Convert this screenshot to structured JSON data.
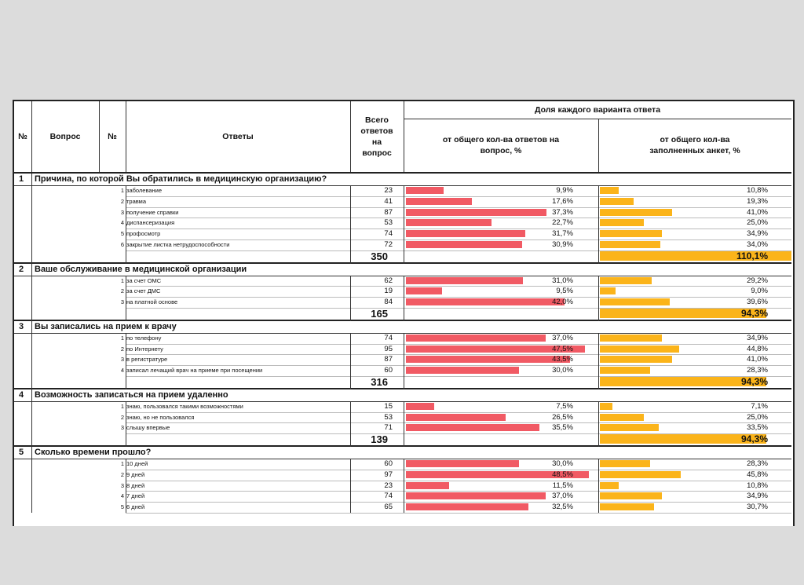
{
  "header": {
    "num": "№",
    "question": "Вопрос",
    "ans_num": "№",
    "answers": "Ответы",
    "total": "Всего ответов на вопрос",
    "share": "Доля каждого варианта ответа",
    "share_answers": "от общего кол-ва ответов на вопрос, %",
    "share_forms": "от общего кол-ва заполненных анкет, %"
  },
  "colors": {
    "answers_bar": "#f15a64",
    "forms_bar": "#fbb41a"
  },
  "questions": [
    {
      "num": "1",
      "text": "Причина, по которой Вы обратились в медицинскую организацию?",
      "total": "350",
      "total_forms_pct": "110,1%",
      "total_forms_value": 110.1,
      "answers": [
        {
          "n": "1",
          "text": "заболевание",
          "count": "23",
          "pct_a": "9,9%",
          "va": 9.9,
          "pct_f": "10,8%",
          "vf": 10.8
        },
        {
          "n": "2",
          "text": "травма",
          "count": "41",
          "pct_a": "17,6%",
          "va": 17.6,
          "pct_f": "19,3%",
          "vf": 19.3
        },
        {
          "n": "3",
          "text": "получение справки",
          "count": "87",
          "pct_a": "37,3%",
          "va": 37.3,
          "pct_f": "41,0%",
          "vf": 41.0
        },
        {
          "n": "4",
          "text": "диспансеризация",
          "count": "53",
          "pct_a": "22,7%",
          "va": 22.7,
          "pct_f": "25,0%",
          "vf": 25.0
        },
        {
          "n": "5",
          "text": "профосмотр",
          "count": "74",
          "pct_a": "31,7%",
          "va": 31.7,
          "pct_f": "34,9%",
          "vf": 34.9
        },
        {
          "n": "6",
          "text": "закрытие листка нетрудоспособности",
          "count": "72",
          "pct_a": "30,9%",
          "va": 30.9,
          "pct_f": "34,0%",
          "vf": 34.0
        }
      ]
    },
    {
      "num": "2",
      "text": "Ваше обслуживание в медицинской организации",
      "total": "165",
      "total_forms_pct": "94,3%",
      "total_forms_value": 94.3,
      "answers": [
        {
          "n": "1",
          "text": "за счет ОМС",
          "count": "62",
          "pct_a": "31,0%",
          "va": 31.0,
          "pct_f": "29,2%",
          "vf": 29.2
        },
        {
          "n": "2",
          "text": "за счет ДМС",
          "count": "19",
          "pct_a": "9,5%",
          "va": 9.5,
          "pct_f": "9,0%",
          "vf": 9.0
        },
        {
          "n": "3",
          "text": "на платной основе",
          "count": "84",
          "pct_a": "42,0%",
          "va": 42.0,
          "pct_f": "39,6%",
          "vf": 39.6
        }
      ]
    },
    {
      "num": "3",
      "text": "Вы записались на прием к врачу",
      "total": "316",
      "total_forms_pct": "94,3%",
      "total_forms_value": 94.3,
      "answers": [
        {
          "n": "1",
          "text": "по телефону",
          "count": "74",
          "pct_a": "37,0%",
          "va": 37.0,
          "pct_f": "34,9%",
          "vf": 34.9
        },
        {
          "n": "2",
          "text": "по Интернету",
          "count": "95",
          "pct_a": "47,5%",
          "va": 47.5,
          "pct_f": "44,8%",
          "vf": 44.8
        },
        {
          "n": "3",
          "text": "в регистратуре",
          "count": "87",
          "pct_a": "43,5%",
          "va": 43.5,
          "pct_f": "41,0%",
          "vf": 41.0
        },
        {
          "n": "4",
          "text": "записал лечащий врач на приеме при посещении",
          "count": "60",
          "pct_a": "30,0%",
          "va": 30.0,
          "pct_f": "28,3%",
          "vf": 28.3
        }
      ]
    },
    {
      "num": "4",
      "text": "Возможность записаться на прием удаленно",
      "total": "139",
      "total_forms_pct": "94,3%",
      "total_forms_value": 94.3,
      "answers": [
        {
          "n": "1",
          "text": "знаю, пользовался такими возможностями",
          "count": "15",
          "pct_a": "7,5%",
          "va": 7.5,
          "pct_f": "7,1%",
          "vf": 7.1
        },
        {
          "n": "2",
          "text": "знаю, но не пользовался",
          "count": "53",
          "pct_a": "26,5%",
          "va": 26.5,
          "pct_f": "25,0%",
          "vf": 25.0
        },
        {
          "n": "3",
          "text": "слышу впервые",
          "count": "71",
          "pct_a": "35,5%",
          "va": 35.5,
          "pct_f": "33,5%",
          "vf": 33.5
        }
      ]
    },
    {
      "num": "5",
      "text": "Сколько времени прошло?",
      "answers": [
        {
          "n": "1",
          "text": "10 дней",
          "count": "60",
          "pct_a": "30,0%",
          "va": 30.0,
          "pct_f": "28,3%",
          "vf": 28.3
        },
        {
          "n": "2",
          "text": "9 дней",
          "count": "97",
          "pct_a": "48,5%",
          "va": 48.5,
          "pct_f": "45,8%",
          "vf": 45.8
        },
        {
          "n": "3",
          "text": "8 дней",
          "count": "23",
          "pct_a": "11,5%",
          "va": 11.5,
          "pct_f": "10,8%",
          "vf": 10.8
        },
        {
          "n": "4",
          "text": "7 дней",
          "count": "74",
          "pct_a": "37,0%",
          "va": 37.0,
          "pct_f": "34,9%",
          "vf": 34.9
        },
        {
          "n": "5",
          "text": "6 дней",
          "count": "65",
          "pct_a": "32,5%",
          "va": 32.5,
          "pct_f": "30,7%",
          "vf": 30.7
        }
      ]
    }
  ]
}
